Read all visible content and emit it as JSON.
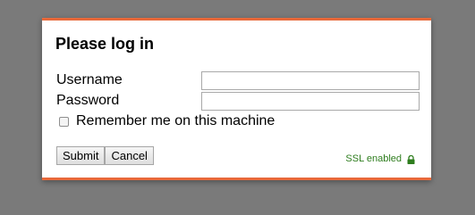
{
  "dialog": {
    "title": "Please log in",
    "username_label": "Username",
    "username_value": "",
    "password_label": "Password",
    "password_value": "",
    "remember_label": "Remember me on this machine",
    "remember_checked": false,
    "submit_label": "Submit",
    "cancel_label": "Cancel",
    "ssl_text": "SSL enabled",
    "ssl_icon": "lock-icon"
  },
  "colors": {
    "background": "#7a7a7a",
    "dialog_border": "#e8693a",
    "ssl_text": "#2e7d1e"
  }
}
